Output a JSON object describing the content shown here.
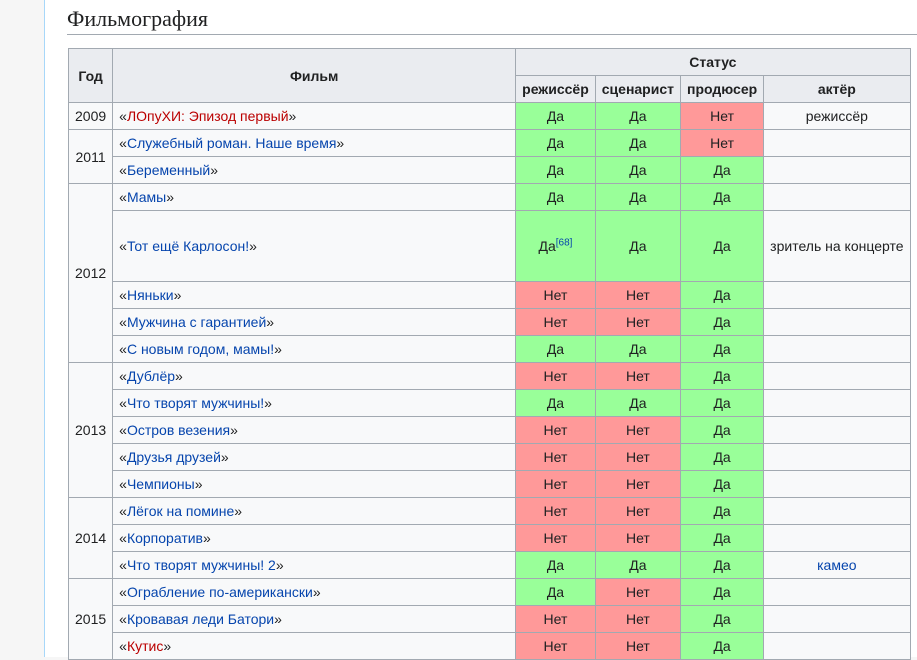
{
  "section": {
    "title": "Фильмография"
  },
  "table": {
    "headers": {
      "year": "Год",
      "film": "Фильм",
      "status": "Статус",
      "director": "режиссёр",
      "writer": "сценарист",
      "producer": "продюсер",
      "actor": "актёр"
    },
    "groups": [
      {
        "year": "2009",
        "rows": [
          {
            "film": "ЛОпуХИ: Эпизод первый",
            "red": true,
            "director": "Да",
            "writer": "Да",
            "producer": "Нет",
            "actor": "режиссёр"
          }
        ]
      },
      {
        "year": "2011",
        "rows": [
          {
            "film": "Служебный роман. Наше время",
            "director": "Да",
            "writer": "Да",
            "producer": "Нет",
            "actor": ""
          },
          {
            "film": "Беременный",
            "director": "Да",
            "writer": "Да",
            "producer": "Да",
            "actor": ""
          }
        ]
      },
      {
        "year": "2012",
        "rows": [
          {
            "film": "Мамы",
            "director": "Да",
            "writer": "Да",
            "producer": "Да",
            "actor": ""
          },
          {
            "film": "Тот ещё Карлосон!",
            "director": "Да",
            "director_ref": "[68]",
            "writer": "Да",
            "producer": "Да",
            "actor": "зритель на концерте",
            "tall": true
          },
          {
            "film": "Няньки",
            "director": "Нет",
            "writer": "Нет",
            "producer": "Да",
            "actor": ""
          },
          {
            "film": "Мужчина с гарантией",
            "director": "Нет",
            "writer": "Нет",
            "producer": "Да",
            "actor": ""
          },
          {
            "film": "С новым годом, мамы!",
            "director": "Да",
            "writer": "Да",
            "producer": "Да",
            "actor": ""
          }
        ]
      },
      {
        "year": "2013",
        "rows": [
          {
            "film": "Дублёр",
            "director": "Нет",
            "writer": "Нет",
            "producer": "Да",
            "actor": ""
          },
          {
            "film": "Что творят мужчины!",
            "director": "Да",
            "writer": "Да",
            "producer": "Да",
            "actor": ""
          },
          {
            "film": "Остров везения",
            "director": "Нет",
            "writer": "Нет",
            "producer": "Да",
            "actor": ""
          },
          {
            "film": "Друзья друзей",
            "director": "Нет",
            "writer": "Нет",
            "producer": "Да",
            "actor": ""
          },
          {
            "film": "Чемпионы",
            "director": "Нет",
            "writer": "Нет",
            "producer": "Да",
            "actor": ""
          }
        ]
      },
      {
        "year": "2014",
        "rows": [
          {
            "film": "Лёгок на помине",
            "director": "Нет",
            "writer": "Нет",
            "producer": "Да",
            "actor": ""
          },
          {
            "film": "Корпоратив",
            "director": "Нет",
            "writer": "Нет",
            "producer": "Да",
            "actor": ""
          },
          {
            "film": "Что творят мужчины! 2",
            "director": "Да",
            "writer": "Да",
            "producer": "Да",
            "actor": "камео",
            "actor_link": true
          }
        ]
      },
      {
        "year": "2015",
        "rows": [
          {
            "film": "Ограбление по-американски",
            "director": "Да",
            "writer": "Нет",
            "producer": "Да",
            "actor": ""
          },
          {
            "film": "Кровавая леди Батори",
            "director": "Нет",
            "writer": "Нет",
            "producer": "Да",
            "actor": ""
          },
          {
            "film": "Кутис",
            "red": true,
            "director": "Нет",
            "writer": "Нет",
            "producer": "Да",
            "actor": ""
          }
        ]
      }
    ]
  },
  "colors": {
    "yes": "#99ff99",
    "no": "#ff9999",
    "link": "#0645ad",
    "redlink": "#ba0000"
  }
}
